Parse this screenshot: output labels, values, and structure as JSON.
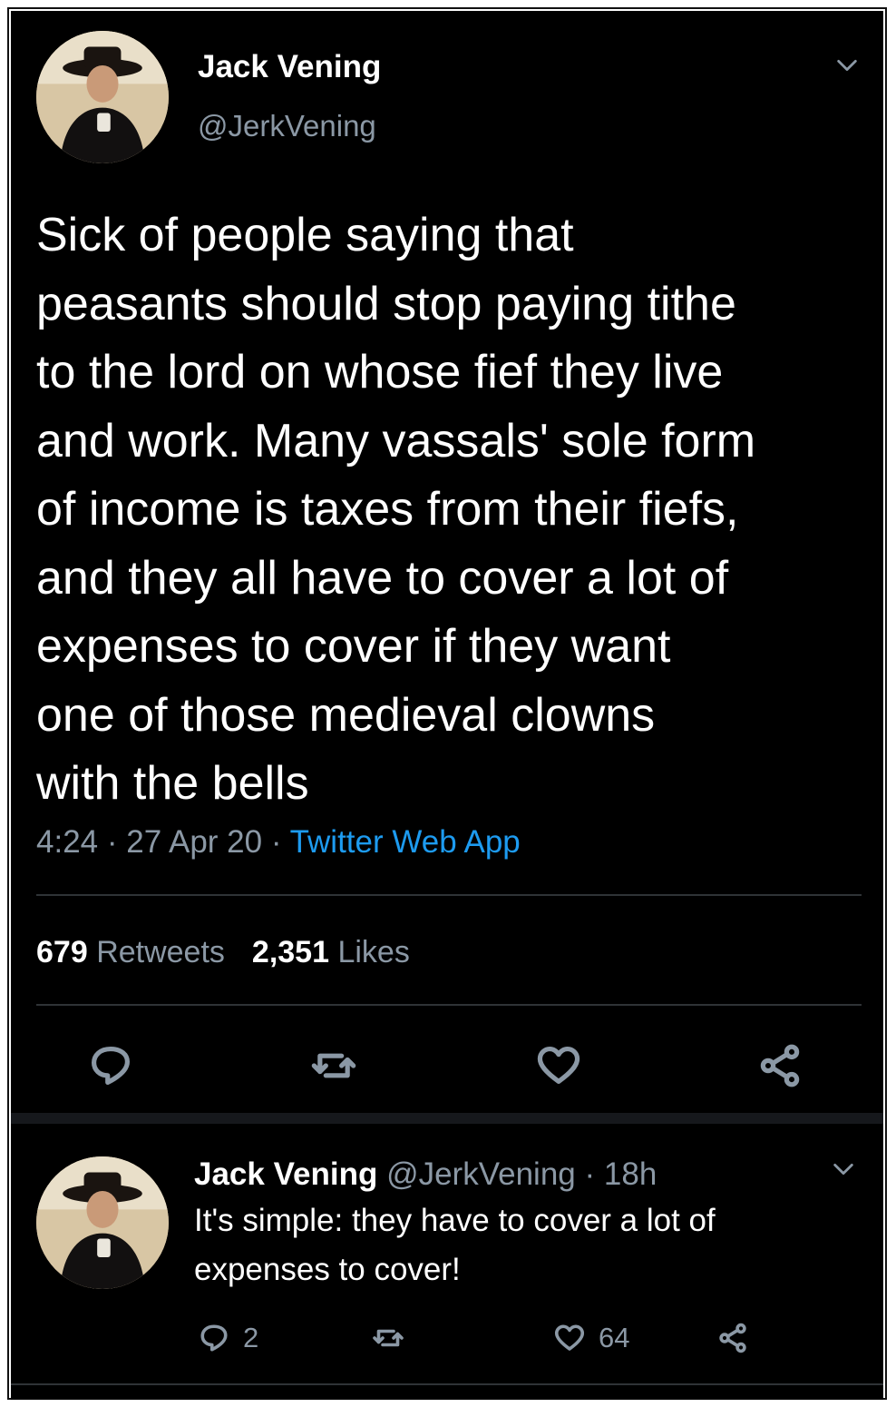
{
  "tweet": {
    "author": {
      "name": "Jack Vening",
      "handle": "@JerkVening"
    },
    "text": "Sick of people saying that\npeasants should stop paying tithe\nto the lord on whose fief they live\nand work. Many vassals' sole form\nof income is taxes from their fiefs,\nand they all have to cover a lot of\nexpenses to cover if they want\none of those medieval clowns\nwith the bells",
    "time": "4:24",
    "date": "27 Apr 20",
    "source": "Twitter Web App",
    "retweets_count": "679",
    "retweets_label": "Retweets",
    "likes_count": "2,351",
    "likes_label": "Likes",
    "actions": [
      "reply-icon",
      "retweet-icon",
      "like-icon",
      "share-icon"
    ]
  },
  "reply": {
    "author": {
      "name": "Jack Vening",
      "handle": "@JerkVening"
    },
    "time": "18h",
    "text": "It's simple: they have to cover a lot of expenses to cover!",
    "reply_count": "2",
    "like_count": "64"
  },
  "colors": {
    "background": "#000000",
    "text": "#ffffff",
    "muted": "#8b98a5",
    "link": "#1d9bf0",
    "divider": "#2f3336"
  }
}
